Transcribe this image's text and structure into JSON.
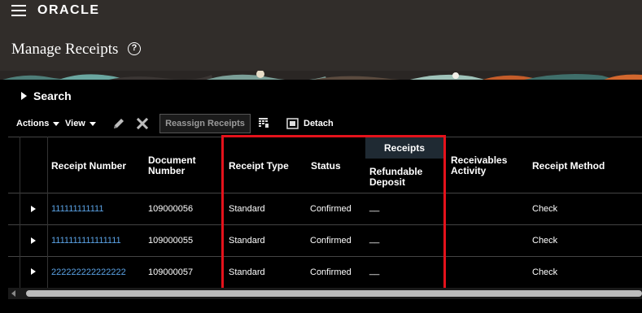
{
  "header": {
    "logo": "ORACLE"
  },
  "page": {
    "title": "Manage Receipts",
    "help_glyph": "?"
  },
  "search": {
    "label": "Search"
  },
  "toolbar": {
    "actions_label": "Actions",
    "view_label": "View",
    "reassign_label": "Reassign Receipts",
    "detach_label": "Detach"
  },
  "table": {
    "columns": {
      "receipt_number": "Receipt Number",
      "document_number": [
        "Document",
        "Number"
      ],
      "receipt_type": "Receipt Type",
      "status": "Status",
      "receipts_group": "Receipts",
      "refundable_deposit": [
        "Refundable",
        "Deposit"
      ],
      "receivables_activity": [
        "Receivables",
        "Activity"
      ],
      "receipt_method": "Receipt Method"
    },
    "rows": [
      {
        "receipt_number": "111111111111",
        "document_number": "109000056",
        "receipt_type": "Standard",
        "status": "Confirmed",
        "refundable_deposit": "__",
        "receivables_activity": "",
        "receipt_method": "Check"
      },
      {
        "receipt_number": "1111111111111111",
        "document_number": "109000055",
        "receipt_type": "Standard",
        "status": "Confirmed",
        "refundable_deposit": "__",
        "receivables_activity": "",
        "receipt_method": "Check"
      },
      {
        "receipt_number": "222222222222222",
        "document_number": "109000057",
        "receipt_type": "Standard",
        "status": "Confirmed",
        "refundable_deposit": "__",
        "receivables_activity": "",
        "receipt_method": "Check"
      }
    ]
  },
  "colors": {
    "header_bg": "#312d2a",
    "link": "#5ba3e6",
    "highlight": "#e4121b",
    "group_header_bg": "#1f2a33"
  }
}
